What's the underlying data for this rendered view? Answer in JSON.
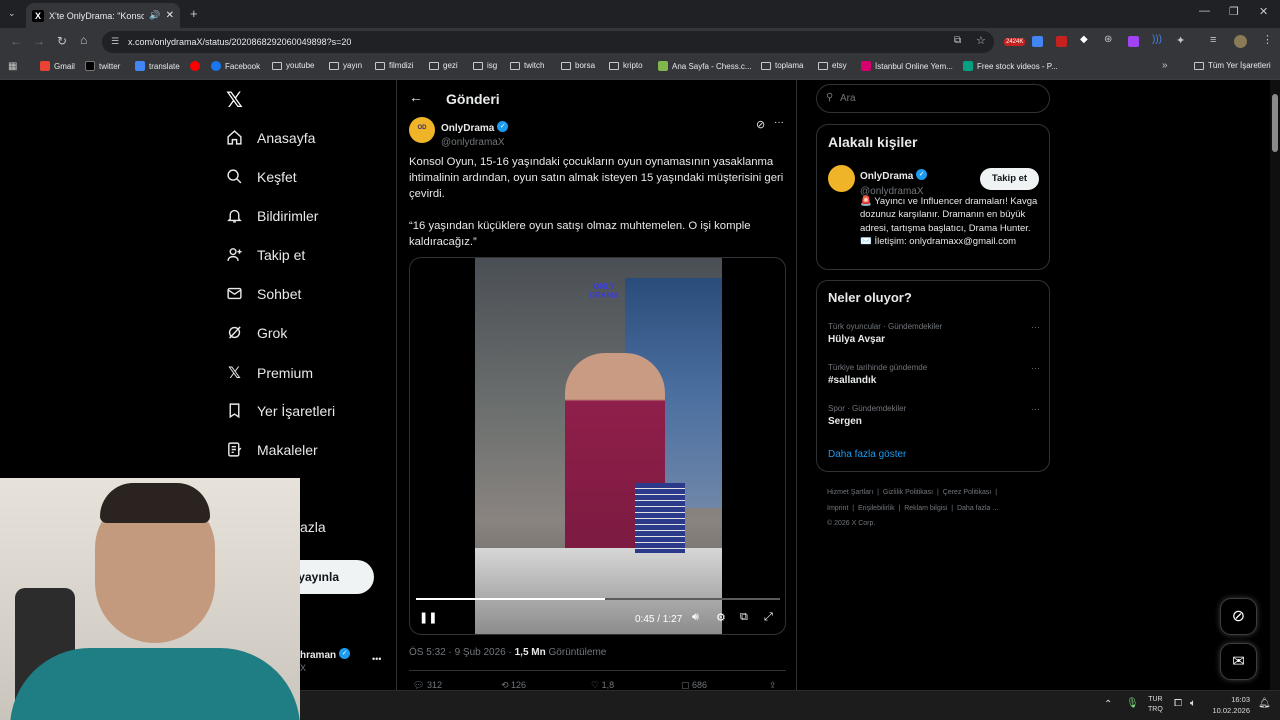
{
  "browser": {
    "tab_title": "X'te OnlyDrama: \"Konsol O...",
    "url": "x.com/onlydramaX/status/2020868292060049898?s=20",
    "bookmarks": [
      "Gmail",
      "twitter",
      "translate",
      "Facebook",
      "youtube",
      "yayın",
      "filmdizi",
      "gezi",
      "isg",
      "twitch",
      "borsa",
      "kripto",
      "Ana Sayfa - Chess.c...",
      "toplama",
      "etsy",
      "İstanbul Online Yem...",
      "Free stock videos - P..."
    ],
    "all_bookmarks": "Tüm Yer İşaretleri",
    "ext_badge": "2424K"
  },
  "nav": {
    "items": [
      "Anasayfa",
      "Keşfet",
      "Bildirimler",
      "Takip et",
      "Sohbet",
      "Grok",
      "Premium",
      "Yer İşaretleri",
      "Makaleler"
    ],
    "more_partial": "azla",
    "post_partial": "yayınla",
    "account_partial": "hraman",
    "account_handle_partial": "X",
    "more_dots": "•••"
  },
  "post": {
    "header": "Gönderi",
    "author": "OnlyDrama",
    "handle": "@onlydramaX",
    "text1": "Konsol Oyun, 15-16 yaşındaki çocukların oyun oynamasının yasaklanma ihtimalinin ardından, oyun satın almak isteyen 15 yaşındaki müşterisini geri çevirdi.",
    "text2": "“16 yaşından küçüklere oyun satışı olmaz muhtemelen. O işi komple kaldıracağız.”",
    "video_time": "0:45 / 1:27",
    "video_logo": "ONLY DRAMA",
    "progress": 0.52,
    "meta_time": "ÖS 5:32 · 9 Şub 2026 · ",
    "meta_views_num": "1,5 Mn",
    "meta_views_label": " Görüntüleme",
    "stats": [
      "312",
      "126",
      "1,8",
      "686"
    ]
  },
  "right": {
    "search_placeholder": "Ara",
    "related_title": "Alakalı kişiler",
    "rel_name": "OnlyDrama",
    "rel_handle": "@onlydramaX",
    "follow_label": "Takip et",
    "rel_bio": "🚨 Yayıncı ve Influencer dramaları! Kavga dozunuz karşılanır. Dramanın en büyük adresi, tartışma başlatıcı, Drama Hunter. ✉️ İletişim: onlydramaxx@gmail.com",
    "trends_title": "Neler oluyor?",
    "trends": [
      {
        "context": "Türk oyuncular · Gündemdekiler",
        "name": "Hülya Avşar"
      },
      {
        "context": "Türkiye tarihinde gündemde",
        "name": "#sallandık"
      },
      {
        "context": "Spor · Gündemdekiler",
        "name": "Sergen"
      }
    ],
    "show_more": "Daha fazla göster",
    "footer": [
      "Hizmet Şartları",
      "Gizlilik Politikası",
      "Çerez Politikası",
      "Imprint",
      "Erişilebilirlik",
      "Reklam bilgisi",
      "Daha fazla ..."
    ],
    "copyright": "© 2026 X Corp."
  },
  "taskbar": {
    "lang1": "TUR",
    "lang2": "TRQ",
    "time": "16:03",
    "date": "10.02.2026"
  }
}
